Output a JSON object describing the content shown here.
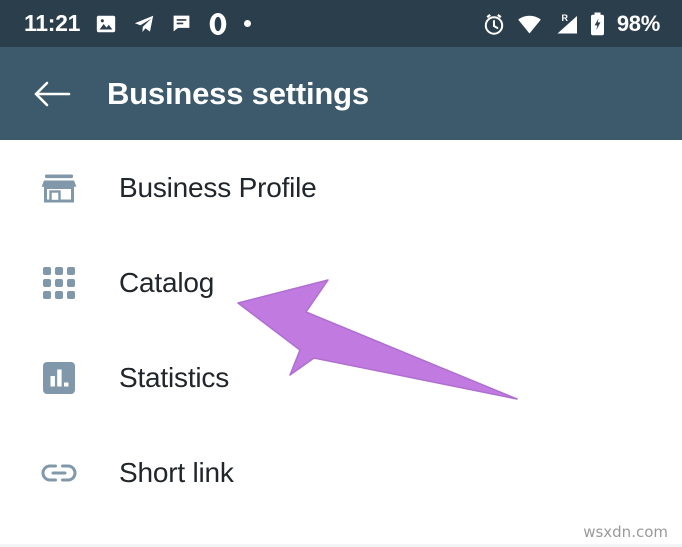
{
  "status_bar": {
    "time": "11:21",
    "battery_percent": "98%",
    "left_icons": [
      {
        "name": "photo-icon"
      },
      {
        "name": "telegram-icon"
      },
      {
        "name": "message-icon"
      },
      {
        "name": "opera-icon"
      },
      {
        "name": "dot-icon"
      }
    ],
    "right_icons": [
      {
        "name": "alarm-icon"
      },
      {
        "name": "wifi-icon"
      },
      {
        "name": "roaming-signal-icon",
        "label": "R"
      },
      {
        "name": "battery-charging-icon"
      }
    ],
    "background_color": "#2b3e4c",
    "text_color": "#ffffff"
  },
  "app_bar": {
    "title": "Business settings",
    "back_icon": "back-arrow-icon",
    "background_color": "#3c5a6b",
    "title_color": "#ffffff"
  },
  "list": {
    "items": [
      {
        "label": "Business Profile",
        "icon": "store-icon"
      },
      {
        "label": "Catalog",
        "icon": "grid-icon"
      },
      {
        "label": "Statistics",
        "icon": "bar-chart-icon"
      },
      {
        "label": "Short link",
        "icon": "link-icon"
      }
    ],
    "icon_color": "#8098aa",
    "label_color": "#20262b"
  },
  "annotation": {
    "arrow": {
      "name": "pointer-arrow",
      "color": "#c07ae0",
      "points_to": "Catalog"
    }
  },
  "watermark": {
    "text": "wsxdn.com",
    "color": "#9a9a9a"
  }
}
